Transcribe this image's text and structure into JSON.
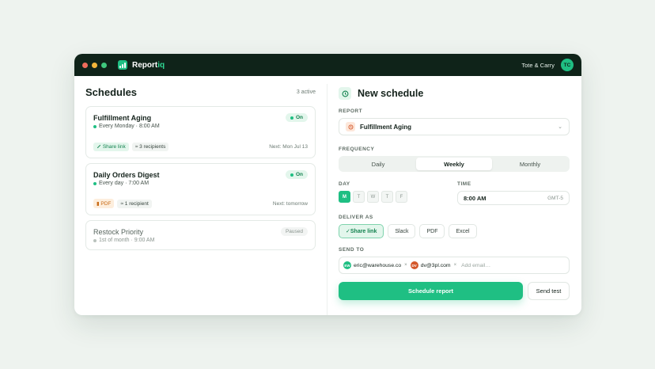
{
  "colors": {
    "accent": "#1fbf83",
    "titlebar": "#0f2319",
    "dot_red": "#ef6b5b",
    "dot_yellow": "#f2b53a",
    "dot_green": "#3fc77d"
  },
  "app": {
    "brand_prefix": "Report",
    "brand_suffix": "iq",
    "workspace": "Tote & Carry",
    "user_initials": "TC"
  },
  "schedules": {
    "title": "Schedules",
    "active_count": "3 active",
    "items": [
      {
        "name": "Fulfillment Aging",
        "status": "On",
        "cadence": "Every Monday · 8:00 AM",
        "format": "Share link",
        "recipients": "3 recipients",
        "next": "Next: Mon Jul 13"
      },
      {
        "name": "Daily Orders Digest",
        "status": "On",
        "cadence": "Every day · 7:00 AM",
        "format": "PDF",
        "recipients": "1 recipient",
        "next": "Next: tomorrow"
      },
      {
        "name": "Restock Priority",
        "status": "Paused",
        "cadence": "1st of month · 9:00 AM"
      }
    ]
  },
  "form": {
    "title": "New schedule",
    "report_label": "REPORT",
    "report_value": "Fulfillment Aging",
    "frequency_label": "FREQUENCY",
    "frequency_options": [
      "Daily",
      "Weekly",
      "Monthly"
    ],
    "frequency_selected": "Weekly",
    "day_label": "DAY",
    "days": [
      "M",
      "T",
      "W",
      "T",
      "F"
    ],
    "day_selected": "M",
    "time_label": "TIME",
    "time_value": "8:00 AM",
    "timezone": "GMT-5",
    "deliver_label": "DELIVER AS",
    "deliver_options": [
      "Share link",
      "Slack",
      "PDF",
      "Excel"
    ],
    "deliver_selected": "Share link",
    "sendto_label": "SEND TO",
    "recipients": [
      {
        "initials": "EW",
        "email": "eric@warehouse.co",
        "color": "#1fbf83"
      },
      {
        "initials": "DV",
        "email": "dv@3pl.com",
        "color": "#d4572a"
      }
    ],
    "add_email_placeholder": "Add email…",
    "submit_label": "Schedule report",
    "test_label": "Send test"
  }
}
